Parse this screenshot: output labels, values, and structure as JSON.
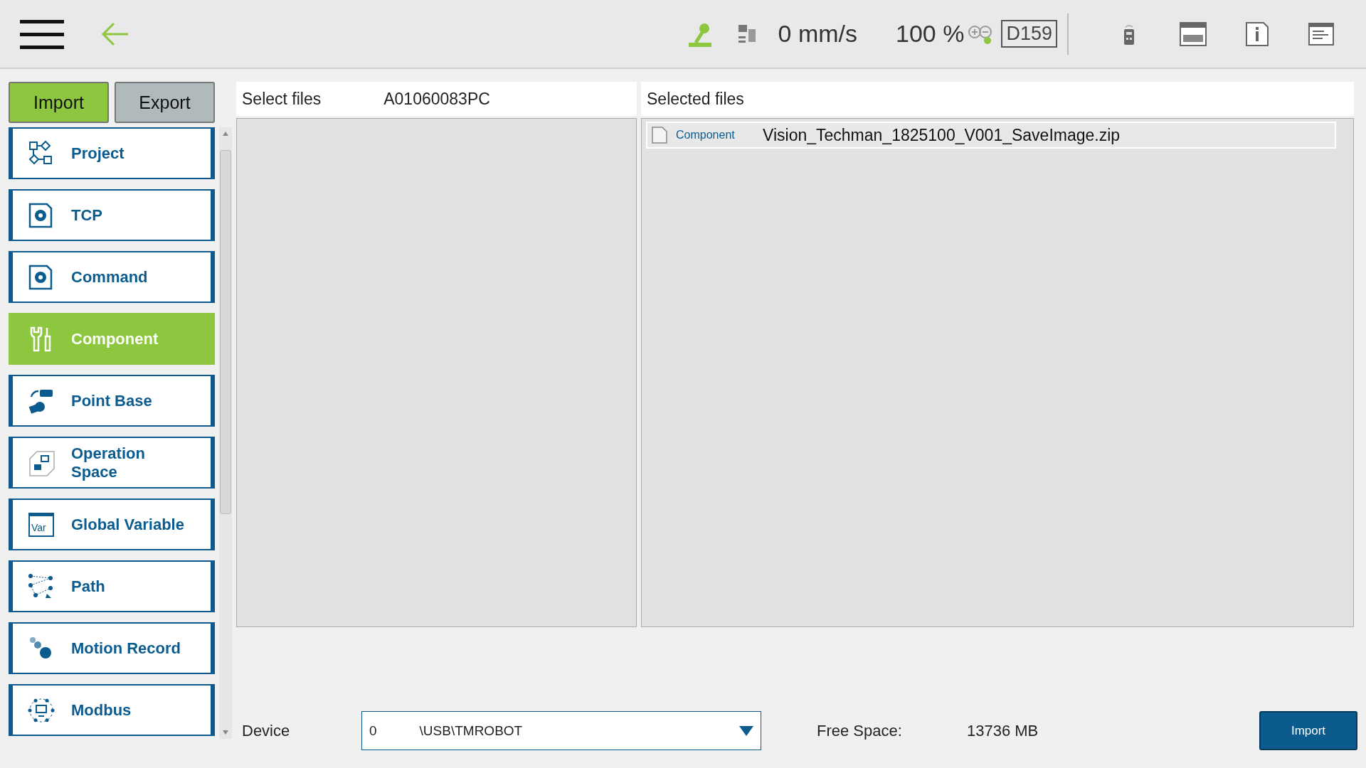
{
  "top_bar": {
    "speed": "0 mm/s",
    "percent": "100 %",
    "code": "D159"
  },
  "mode_tabs": [
    {
      "label": "Import",
      "selected": true
    },
    {
      "label": "Export",
      "selected": false
    }
  ],
  "sidebar": {
    "items": [
      {
        "label": "Project",
        "kind": "project",
        "selected": false
      },
      {
        "label": "TCP",
        "kind": "gear",
        "selected": false
      },
      {
        "label": "Command",
        "kind": "gear",
        "selected": false
      },
      {
        "label": "Component",
        "kind": "tools",
        "selected": true
      },
      {
        "label": "Point Base",
        "kind": "pointbase",
        "selected": false
      },
      {
        "label": "Operation Space",
        "kind": "space",
        "selected": false
      },
      {
        "label": "Global Variable",
        "kind": "var",
        "icon_text": "Var",
        "selected": false
      },
      {
        "label": "Path",
        "kind": "path",
        "selected": false
      },
      {
        "label": "Motion Record",
        "kind": "motion",
        "selected": false
      },
      {
        "label": "Modbus",
        "kind": "modbus",
        "selected": false
      }
    ]
  },
  "select_panel": {
    "title": "Select files",
    "source": "A01060083PC"
  },
  "selected_panel": {
    "title": "Selected files",
    "files": [
      {
        "tag": "Component",
        "name": "Vision_Techman_1825100_V001_SaveImage.zip"
      }
    ]
  },
  "footer": {
    "device_label": "Device",
    "device_index": "0",
    "device_path": "\\USB\\TMROBOT",
    "free_space_label": "Free Space:",
    "free_space_value": "13736 MB",
    "button": "Import"
  }
}
